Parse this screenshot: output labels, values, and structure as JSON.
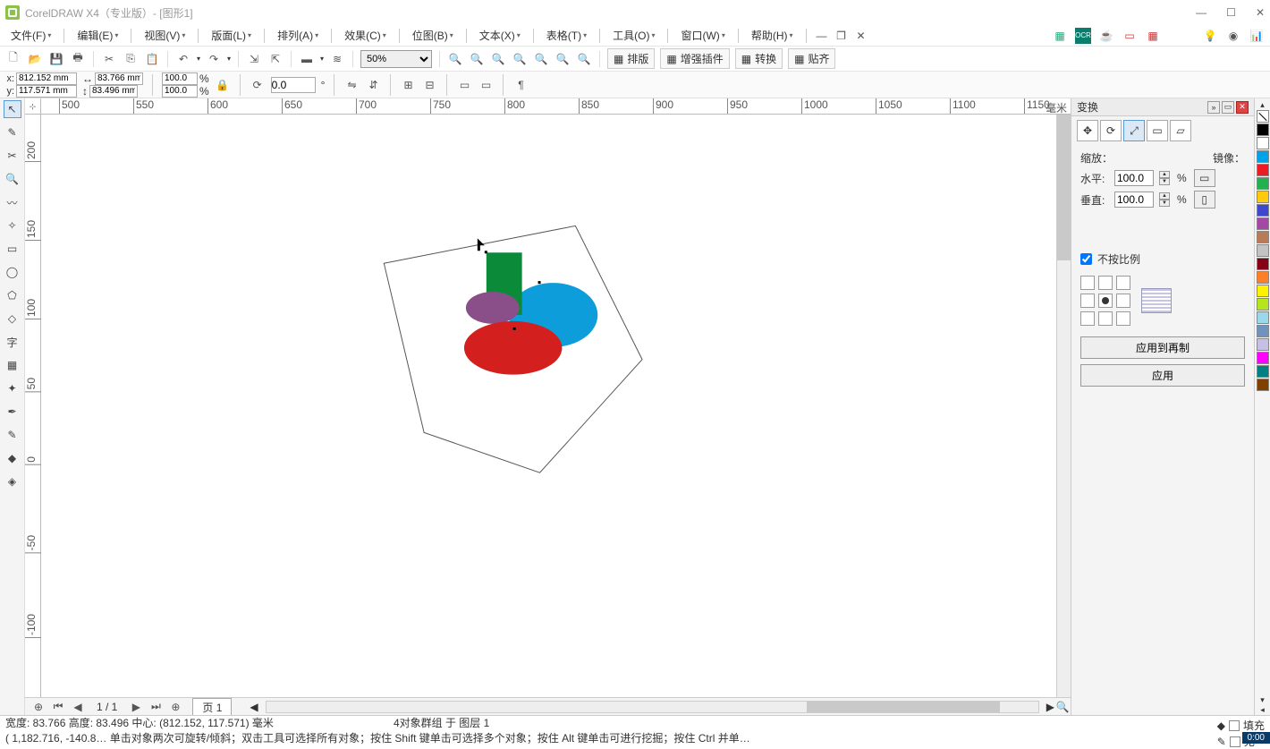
{
  "title": "CorelDRAW X4（专业版）- [图形1]",
  "menus": [
    "文件(F)",
    "编辑(E)",
    "视图(V)",
    "版面(L)",
    "排列(A)",
    "效果(C)",
    "位图(B)",
    "文本(X)",
    "表格(T)",
    "工具(O)",
    "窗口(W)",
    "帮助(H)"
  ],
  "zoom": "50%",
  "toolbar_labels": {
    "paiban": "排版",
    "zengqiang": "增强插件",
    "zhuanhuan": "转换",
    "tieqi": "贴齐"
  },
  "coords": {
    "x": "812.152 mm",
    "y": "117.571 mm",
    "w": "83.766 mm",
    "h": "83.496 mm",
    "sx": "100.0",
    "sy": "100.0",
    "rot": "0.0"
  },
  "ruler_h": [
    "500",
    "550",
    "600",
    "650",
    "700",
    "750",
    "800",
    "850",
    "900",
    "950",
    "1000",
    "1050",
    "1100",
    "1150"
  ],
  "ruler_h_unit": "毫米",
  "ruler_v": [
    "200",
    "150",
    "100",
    "50",
    "0",
    "-50",
    "-100"
  ],
  "page": {
    "num": "1 / 1",
    "tab": "页 1"
  },
  "status": {
    "line1_a": "宽度: 83.766  高度: 83.496  中心: (812.152, 117.571)  毫米",
    "line1_b": "4对象群组 于 图层 1",
    "line2": "( 1,182.716, -140.8…    单击对象两次可旋转/倾斜；双击工具可选择所有对象；按住 Shift 键单击可选择多个对象；按住 Alt 键单击可进行挖掘；按住 Ctrl 并单…",
    "fill": "填充",
    "none": "无",
    "clock": "0:00"
  },
  "transform": {
    "title": "变换",
    "scale_lbl": "缩放：",
    "mirror_lbl": "镜像：",
    "h_lbl": "水平:",
    "v_lbl": "垂直:",
    "h_val": "100.0",
    "v_val": "100.0",
    "pct": "%",
    "nonprop": "不按比例",
    "apply_copy": "应用到再制",
    "apply": "应用"
  },
  "palette": [
    "#000000",
    "#ffffff",
    "#00a2e8",
    "#ed1c24",
    "#22b14c",
    "#ffc90e",
    "#3f48cc",
    "#a349a4",
    "#b97a57",
    "#c3c3c3",
    "#880015",
    "#ff7f27",
    "#fff200",
    "#b5e61d",
    "#99d9ea",
    "#7092be",
    "#c8bfe7",
    "#ff00ff",
    "#008080",
    "#804000"
  ]
}
